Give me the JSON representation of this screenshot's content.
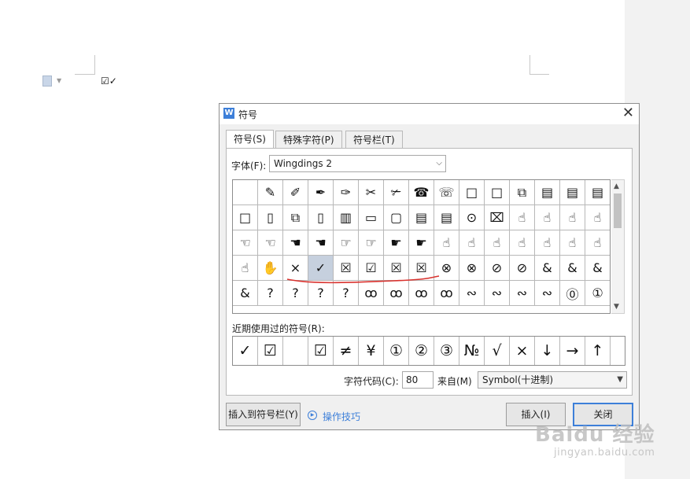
{
  "document": {
    "text": "☑✓"
  },
  "dialog": {
    "title": "符号",
    "tabs": [
      {
        "label": "符号(S)"
      },
      {
        "label": "特殊字符(P)"
      },
      {
        "label": "符号栏(T)"
      }
    ],
    "font_label": "字体(F):",
    "font_value": "Wingdings 2",
    "symbol_grid": [
      [
        "",
        "✎",
        "✐",
        "✒",
        "✑",
        "✂",
        "✃",
        "☎",
        "☏",
        "□",
        "□",
        "⧉",
        "▤",
        "▤",
        "▤"
      ],
      [
        "□",
        "▯",
        "⧉",
        "▯",
        "▥",
        "▭",
        "▢",
        "▤",
        "▤",
        "⊙",
        "⌧",
        "☝",
        "☝",
        "☝",
        "☝"
      ],
      [
        "☜",
        "☜",
        "☚",
        "☚",
        "☞",
        "☞",
        "☛",
        "☛",
        "☝",
        "☝",
        "☝",
        "☝",
        "☝",
        "☝",
        "☝"
      ],
      [
        "☝",
        "✋",
        "×",
        "✓",
        "☒",
        "☑",
        "☒",
        "☒",
        "⊗",
        "⊗",
        "⊘",
        "⊘",
        "&",
        "&",
        "&"
      ],
      [
        "&",
        "?",
        "?",
        "?",
        "?",
        "ꝏ",
        "ꝏ",
        "ꝏ",
        "ꝏ",
        "∾",
        "∾",
        "∾",
        "∾",
        "⓪",
        "①"
      ]
    ],
    "recent_label": "近期使用过的符号(R):",
    "recent_symbols": [
      "✓",
      "☑",
      "",
      "☑",
      "≠",
      "¥",
      "①",
      "②",
      "③",
      "№",
      "√",
      "×",
      "↓",
      "→",
      "↑"
    ],
    "char_code_label": "字符代码(C):",
    "char_code_value": "80",
    "from_label": "来自(M)",
    "from_value": "Symbol(十进制)",
    "insert_to_bar_button": "插入到符号栏(Y)",
    "tips_link": "操作技巧",
    "insert_button": "插入(I)",
    "close_button": "关闭"
  },
  "watermark": {
    "main": "Baidu 经验",
    "sub": "jingyan.baidu.com"
  },
  "colors": {
    "accent": "#3d7fd9",
    "selection": "#c6d0de",
    "annotation": "#d9322e"
  }
}
